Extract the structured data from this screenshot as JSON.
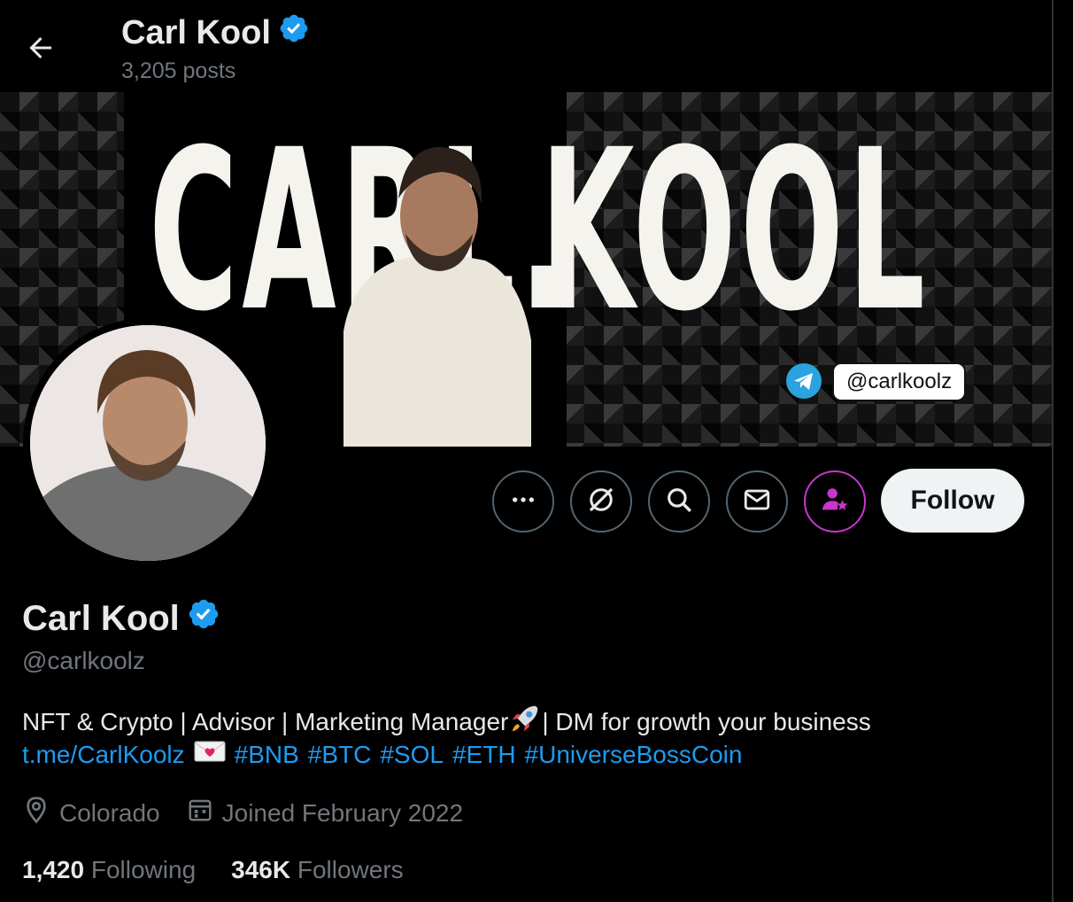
{
  "header": {
    "name": "Carl Kool",
    "posts": "3,205 posts"
  },
  "banner": {
    "left_text": "CARL.",
    "right_text": "KOOL",
    "handle_pill": "@carlkoolz"
  },
  "actions": {
    "more": "more-options",
    "grok": "grok-icon",
    "search": "search-icon",
    "message": "mail-icon",
    "subscribe": "subscribe-icon",
    "follow_label": "Follow"
  },
  "profile": {
    "name": "Carl Kool",
    "handle": "@carlkoolz",
    "bio_line1": "NFT & Crypto | Advisor | Marketing Manager",
    "bio_line1_tail": "| DM for growth your business",
    "bio_link": "t.me/CarlKoolz",
    "hashtags": [
      "#BNB",
      "#BTC",
      "#SOL",
      "#ETH",
      "#UniverseBossCoin"
    ],
    "location": "Colorado",
    "joined": "Joined February 2022",
    "following_count": "1,420",
    "following_label": "Following",
    "followers_count": "346K",
    "followers_label": "Followers"
  },
  "colors": {
    "accent": "#1d9bf0",
    "verified": "#1d9bf0",
    "subscribe": "#c936cc",
    "muted": "#71767b"
  }
}
